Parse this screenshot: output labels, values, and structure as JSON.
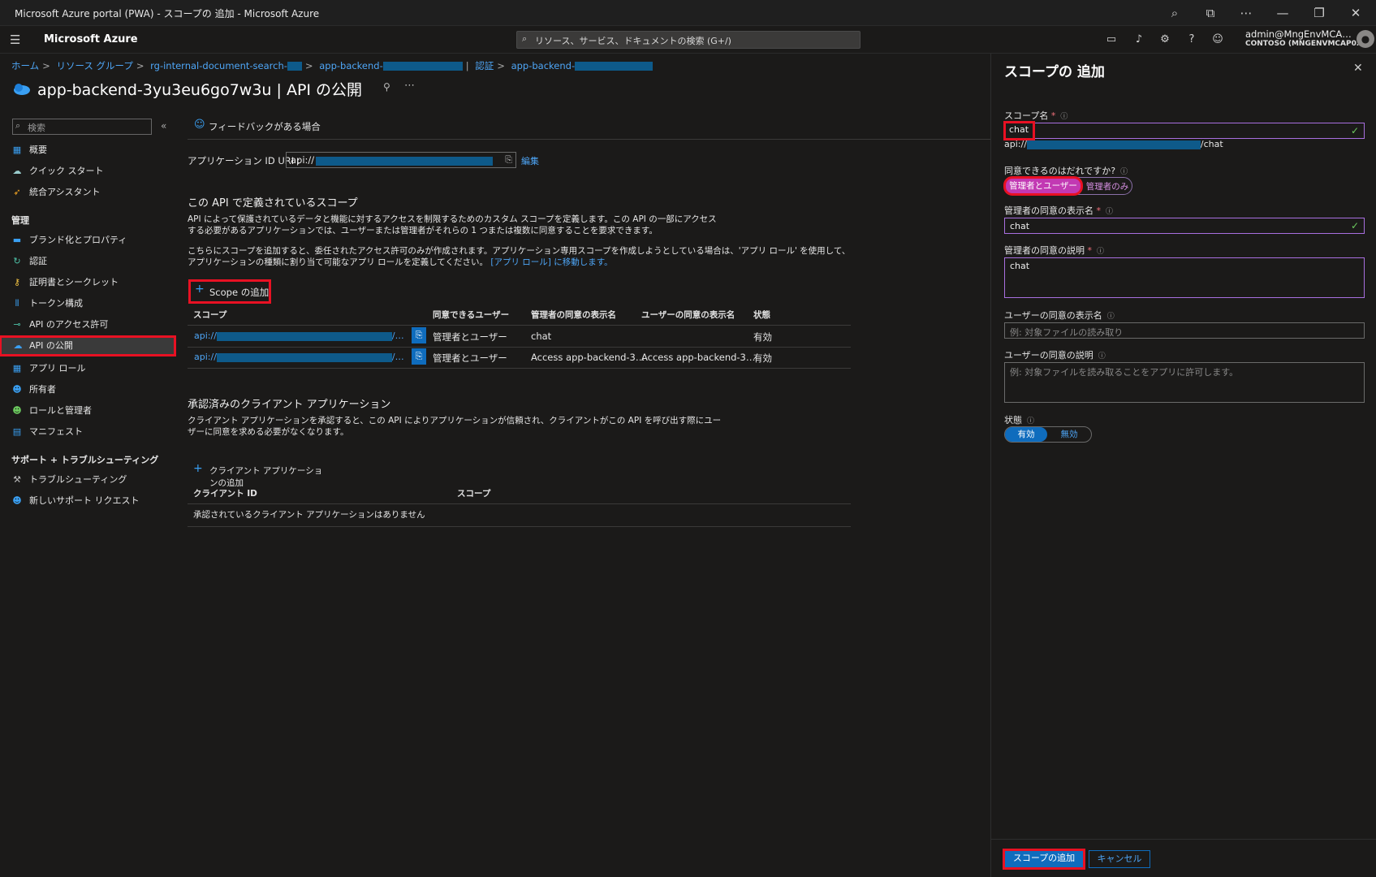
{
  "window": {
    "title": "Microsoft Azure portal (PWA) - スコープの 追加 - Microsoft Azure"
  },
  "topbar": {
    "brand": "Microsoft Azure",
    "search_placeholder": "リソース、サービス、ドキュメントの検索 (G+/)",
    "account_name": "admin@MngEnvMCA…",
    "account_tenant": "CONTOSO (MNGENVMCAP0…"
  },
  "breadcrumb": {
    "items": [
      "ホーム",
      "リソース グループ",
      "rg-internal-document-search-",
      "app-backend-",
      "認証",
      "app-backend-"
    ]
  },
  "page": {
    "title": "app-backend-3yu3eu6go7w3u | API の公開"
  },
  "sidebar": {
    "search_placeholder": "検索",
    "items_top": [
      "概要",
      "クイック スタート",
      "統合アシスタント"
    ],
    "section_manage": "管理",
    "items_manage": [
      "ブランド化とプロパティ",
      "認証",
      "証明書とシークレット",
      "トークン構成",
      "API のアクセス許可",
      "API の公開",
      "アプリ ロール",
      "所有者",
      "ロールと管理者",
      "マニフェスト"
    ],
    "section_support": "サポート + トラブルシューティング",
    "items_support": [
      "トラブルシューティング",
      "新しいサポート リクエスト"
    ]
  },
  "main": {
    "feedback": "フィードバックがある場合",
    "app_id_uri_label": "アプリケーション ID URI :",
    "app_id_uri_value": "api://",
    "edit_link": "編集",
    "scopes_heading": "この API で定義されているスコープ",
    "scopes_desc1": "API によって保護されているデータと機能に対するアクセスを制限するためのカスタム スコープを定義します。この API の一部にアクセスする必要があるアプリケーションでは、ユーザーまたは管理者がそれらの 1 つまたは複数に同意することを要求できます。",
    "scopes_desc2": "こちらにスコープを追加すると、委任されたアクセス許可のみが作成されます。アプリケーション専用スコープを作成しようとしている場合は、'アプリ ロール' を使用して、アプリケーションの種類に割り当て可能なアプリ ロールを定義してください。",
    "app_roles_link": "[アプリ ロール] に移動します。",
    "add_scope": "Scope の追加",
    "table_headers": [
      "スコープ",
      "同意できるユーザー",
      "管理者の同意の表示名",
      "ユーザーの同意の表示名",
      "状態"
    ],
    "rows": [
      {
        "scope": "api://",
        "who": "管理者とユーザー",
        "admin_name": "chat",
        "user_name": "",
        "state": "有効"
      },
      {
        "scope": "api://",
        "who": "管理者とユーザー",
        "admin_name": "Access app-backend-3…",
        "user_name": "Access app-backend-3…",
        "state": "有効"
      }
    ],
    "clients_heading": "承認済みのクライアント アプリケーション",
    "clients_desc": "クライアント アプリケーションを承認すると、この API によりアプリケーションが信頼され、クライアントがこの API を呼び出す際にユーザーに同意を求める必要がなくなります。",
    "add_client": "クライアント アプリケーションの追加",
    "client_headers": [
      "クライアント ID",
      "スコープ"
    ],
    "client_empty": "承認されているクライアント アプリケーションはありません"
  },
  "panel": {
    "title": "スコープの 追加",
    "scope_name_label": "スコープ名",
    "scope_name_value": "chat",
    "scope_uri_prefix": "api://",
    "scope_uri_suffix": "/chat",
    "consent_label": "同意できるのはだれですか?",
    "consent_opt1": "管理者とユーザー",
    "consent_opt2": "管理者のみ",
    "admin_display_label": "管理者の同意の表示名",
    "admin_display_value": "chat",
    "admin_desc_label": "管理者の同意の説明",
    "admin_desc_value": "chat",
    "user_display_label": "ユーザーの同意の表示名",
    "user_display_placeholder": "例: 対象ファイルの読み取り",
    "user_desc_label": "ユーザーの同意の説明",
    "user_desc_placeholder": "例: 対象ファイルを読み取ることをアプリに許可します。",
    "state_label": "状態",
    "state_on": "有効",
    "state_off": "無効",
    "add_button": "スコープの追加",
    "cancel_button": "キャンセル"
  },
  "colors": {
    "accent": "#0f6cbd",
    "highlight": "#e81123",
    "purple": "#c239b3"
  }
}
